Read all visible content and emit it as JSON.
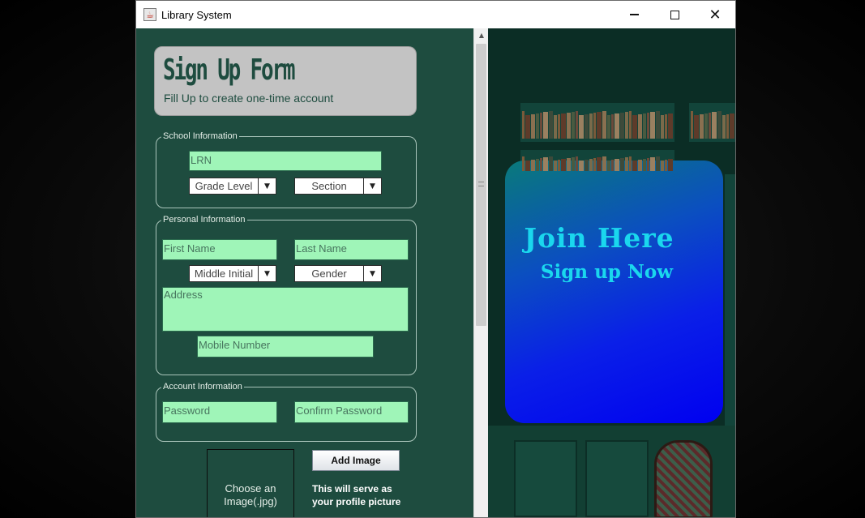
{
  "window": {
    "title": "Library System",
    "app_icon": "java-cup-icon",
    "controls": [
      "minimize-icon",
      "maximize-icon",
      "close-icon"
    ],
    "close_glyph": "✕"
  },
  "header": {
    "title": "Sign Up Form",
    "subtitle": "Fill Up to create one-time account"
  },
  "school": {
    "legend": "School Information",
    "lrn_placeholder": "LRN",
    "grade_level": "Grade Level",
    "section": "Section"
  },
  "personal": {
    "legend": "Personal Information",
    "first_name": "First Name",
    "last_name": "Last Name",
    "middle_initial": "Middle Initial",
    "gender": "Gender",
    "address": "Address",
    "mobile": "Mobile Number"
  },
  "account": {
    "legend": "Account Information",
    "password": "Password",
    "confirm_password": "Confirm Password"
  },
  "image": {
    "choose_text": "Choose an Image(.jpg)",
    "add_button": "Add Image",
    "serve_text": "This will serve as your profile picture"
  },
  "promo": {
    "title": "Join Here",
    "subtitle": "Sign up Now"
  },
  "colors": {
    "window_bg": "#1e4c3f",
    "field_bg": "#9ff5b8",
    "promo_text": "#1ad7ee",
    "promo_card": "#0000f0"
  }
}
